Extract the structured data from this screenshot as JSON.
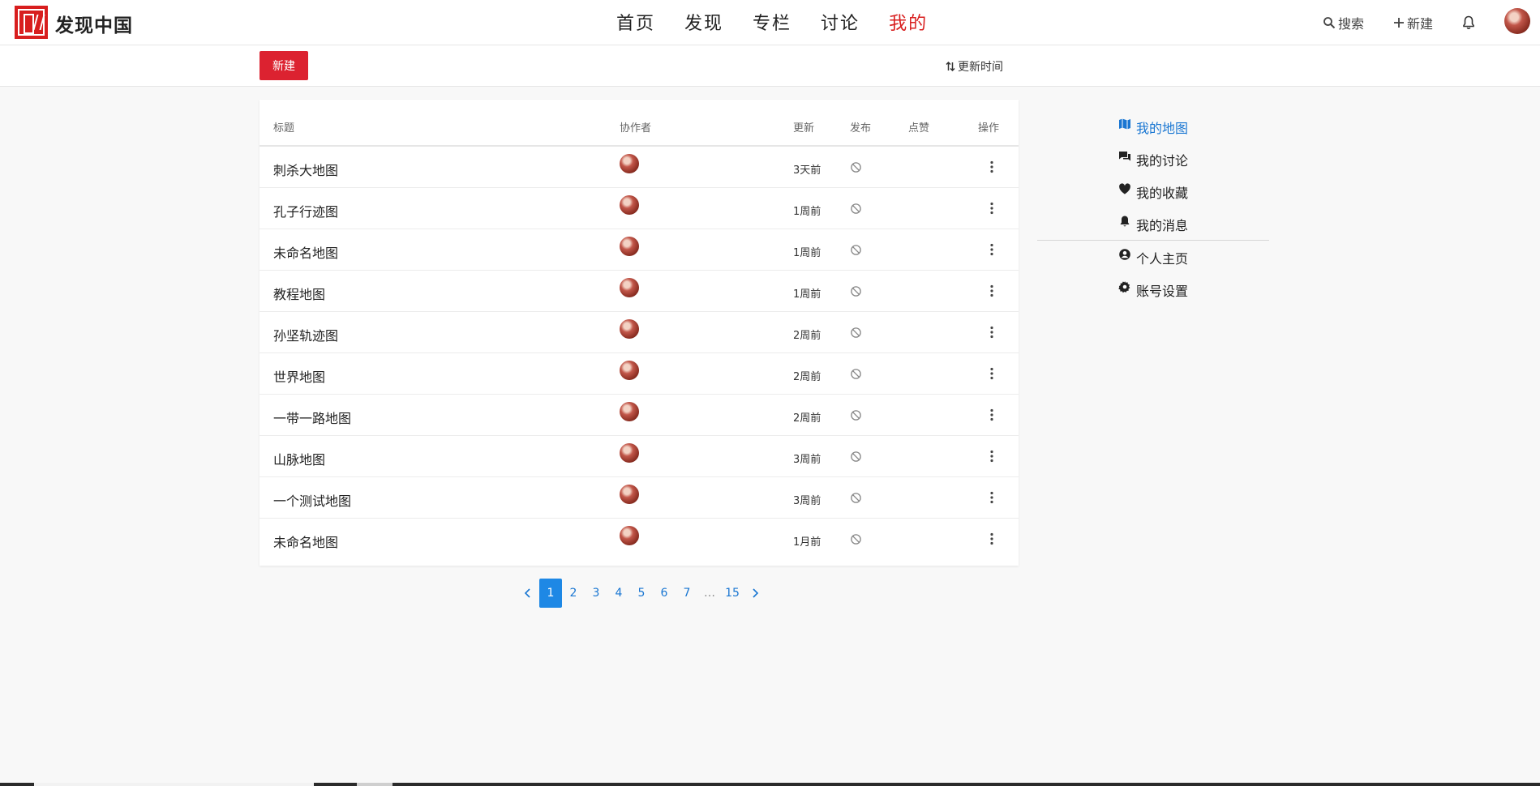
{
  "header": {
    "site_name": "发现中国",
    "nav": [
      "首页",
      "发现",
      "专栏",
      "讨论",
      "我的"
    ],
    "active_nav": "我的",
    "search_label": "搜索",
    "new_label": "新建",
    "accent_color": "#d81e1e"
  },
  "toolbar": {
    "new_button": "新建",
    "sort_label": "更新时间"
  },
  "table": {
    "headers": {
      "title": "标题",
      "collaborators": "协作者",
      "updated": "更新",
      "published": "发布",
      "likes": "点赞",
      "actions": "操作"
    },
    "rows": [
      {
        "title": "刺杀大地图",
        "updated": "3天前"
      },
      {
        "title": "孔子行迹图",
        "updated": "1周前"
      },
      {
        "title": "未命名地图",
        "updated": "1周前"
      },
      {
        "title": "教程地图",
        "updated": "1周前"
      },
      {
        "title": "孙坚轨迹图",
        "updated": "2周前"
      },
      {
        "title": "世界地图",
        "updated": "2周前"
      },
      {
        "title": "一带一路地图",
        "updated": "2周前"
      },
      {
        "title": "山脉地图",
        "updated": "3周前"
      },
      {
        "title": "一个测试地图",
        "updated": "3周前"
      },
      {
        "title": "未命名地图",
        "updated": "1月前"
      }
    ]
  },
  "pagination": {
    "pages": [
      "1",
      "2",
      "3",
      "4",
      "5",
      "6",
      "7",
      "…",
      "15"
    ],
    "current": "1"
  },
  "side_menu": {
    "items": [
      {
        "label": "我的地图",
        "icon": "map-icon",
        "active": true
      },
      {
        "label": "我的讨论",
        "icon": "chat-icon",
        "active": false
      },
      {
        "label": "我的收藏",
        "icon": "heart-icon",
        "active": false
      },
      {
        "label": "我的消息",
        "icon": "bell-icon",
        "active": false
      },
      {
        "label": "个人主页",
        "icon": "user-circle-icon",
        "active": false
      },
      {
        "label": "账号设置",
        "icon": "gear-icon",
        "active": false
      }
    ],
    "active_color": "#1976d2"
  }
}
